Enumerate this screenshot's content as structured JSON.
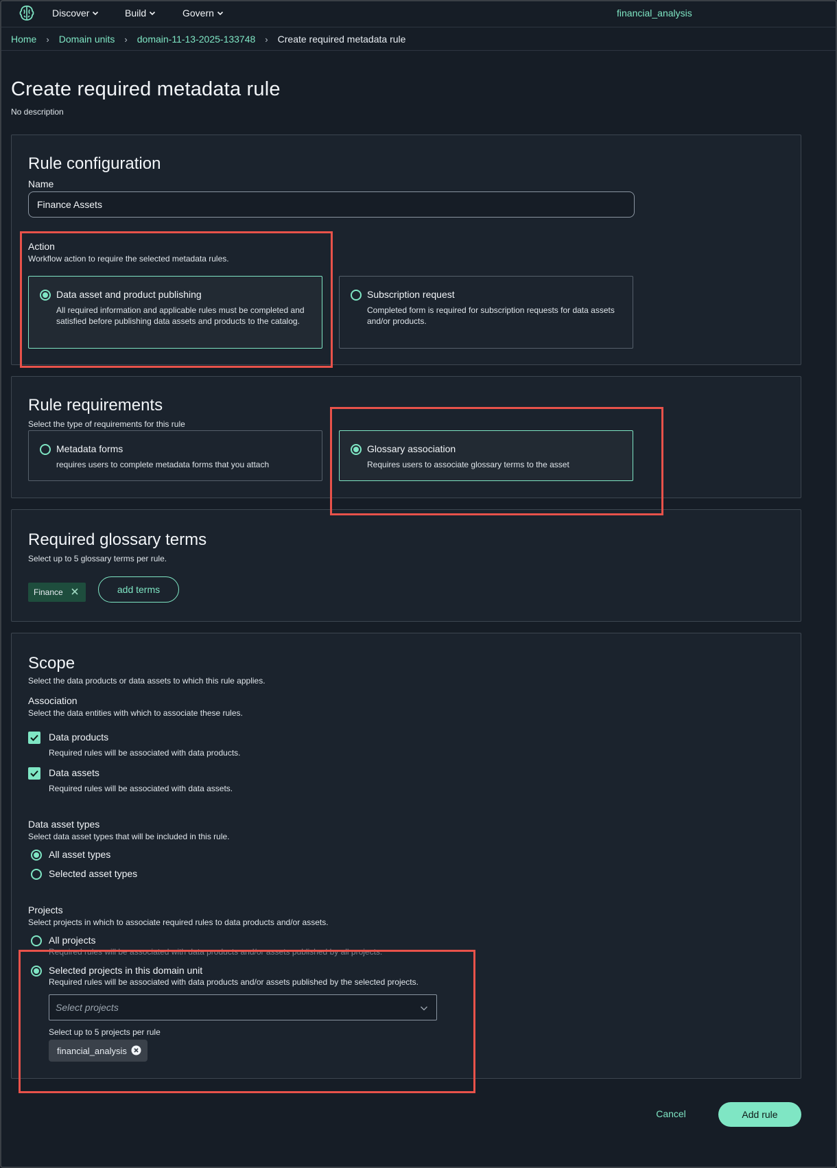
{
  "nav": {
    "items": [
      {
        "label": "Discover"
      },
      {
        "label": "Build"
      },
      {
        "label": "Govern"
      }
    ],
    "project": "financial_analysis"
  },
  "breadcrumb": {
    "home": "Home",
    "domain_units": "Domain units",
    "domain": "domain-11-13-2025-133748",
    "current": "Create required metadata rule"
  },
  "page": {
    "title": "Create required metadata rule",
    "description": "No description"
  },
  "rule_config": {
    "title": "Rule configuration",
    "name_label": "Name",
    "name_value": "Finance Assets",
    "action_label": "Action",
    "action_desc": "Workflow action to require the selected metadata rules.",
    "options": [
      {
        "title": "Data asset and product publishing",
        "desc": "All required information and applicable rules must be completed and satisfied before publishing data assets and products to the catalog.",
        "selected": true
      },
      {
        "title": "Subscription request",
        "desc": "Completed form is required for subscription requests for data assets and/or products.",
        "selected": false
      }
    ]
  },
  "rule_requirements": {
    "title": "Rule requirements",
    "desc": "Select the type of requirements for this rule",
    "options": [
      {
        "title": "Metadata forms",
        "desc": "requires users to complete metadata forms that you attach",
        "selected": false
      },
      {
        "title": "Glossary association",
        "desc": "Requires users to associate glossary terms to the asset",
        "selected": true
      }
    ]
  },
  "glossary": {
    "title": "Required glossary terms",
    "desc": "Select up to 5 glossary terms per rule.",
    "terms": [
      "Finance"
    ],
    "add_label": "add terms"
  },
  "scope": {
    "title": "Scope",
    "desc": "Select the data products or data assets to which this rule applies.",
    "association_label": "Association",
    "association_desc": "Select the data entities with which to associate these rules.",
    "checks": [
      {
        "label": "Data products",
        "desc": "Required rules will be associated with data products.",
        "checked": true
      },
      {
        "label": "Data assets",
        "desc": "Required rules will be associated with data assets.",
        "checked": true
      }
    ],
    "asset_types_label": "Data asset types",
    "asset_types_desc": "Select data asset types that will be included in this rule.",
    "asset_types": [
      {
        "label": "All asset types",
        "selected": true
      },
      {
        "label": "Selected asset types",
        "selected": false
      }
    ],
    "projects_label": "Projects",
    "projects_desc": "Select projects in which to associate required rules to data products and/or assets.",
    "all_projects": {
      "label": "All projects",
      "desc": "Required rules will be associated with data products and/or assets published by all projects.",
      "selected": false
    },
    "selected_projects": {
      "label": "Selected projects in this domain unit",
      "desc": "Required rules will be associated with data products and/or assets published by the selected projects.",
      "selected": true
    },
    "select_placeholder": "Select projects",
    "select_hint": "Select up to 5 projects per rule",
    "chosen_projects": [
      "financial_analysis"
    ]
  },
  "footer": {
    "cancel": "Cancel",
    "add_rule": "Add rule"
  },
  "colors": {
    "accent": "#7fe6c4",
    "background": "#161d26",
    "highlight": "#e8524a"
  }
}
